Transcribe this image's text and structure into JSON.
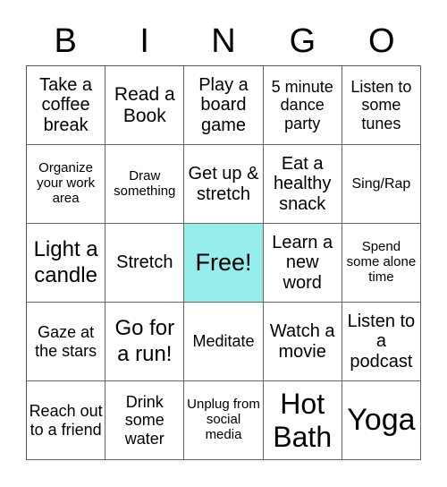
{
  "header": [
    "B",
    "I",
    "N",
    "G",
    "O"
  ],
  "free_color": "#96edeb",
  "cells": [
    {
      "text": "Take a coffee break",
      "size": "s20"
    },
    {
      "text": "Read a Book",
      "size": "s21"
    },
    {
      "text": "Play a board game",
      "size": "s20"
    },
    {
      "text": "5 minute dance party",
      "size": "s18"
    },
    {
      "text": "Listen to some tunes",
      "size": "s18"
    },
    {
      "text": "Organize your work area",
      "size": "s14"
    },
    {
      "text": "Draw something",
      "size": "s14"
    },
    {
      "text": "Get up & stretch",
      "size": "s20"
    },
    {
      "text": "Eat a healthy snack",
      "size": "s20"
    },
    {
      "text": "Sing/Rap",
      "size": "s16"
    },
    {
      "text": "Light a candle",
      "size": "s24"
    },
    {
      "text": "Stretch",
      "size": "s20"
    },
    {
      "text": "Free!",
      "size": "s27",
      "free": true
    },
    {
      "text": "Learn a new word",
      "size": "s20"
    },
    {
      "text": "Spend some alone time",
      "size": "s14"
    },
    {
      "text": "Gaze at the stars",
      "size": "s18"
    },
    {
      "text": "Go for a run!",
      "size": "s24"
    },
    {
      "text": "Meditate",
      "size": "s18"
    },
    {
      "text": "Watch a movie",
      "size": "s20"
    },
    {
      "text": "Listen to a podcast",
      "size": "s20"
    },
    {
      "text": "Reach out to a friend",
      "size": "s18"
    },
    {
      "text": "Drink some water",
      "size": "s18"
    },
    {
      "text": "Unplug from social media",
      "size": "s14"
    },
    {
      "text": "Hot Bath",
      "size": "s32"
    },
    {
      "text": "Yoga",
      "size": "s34"
    }
  ]
}
